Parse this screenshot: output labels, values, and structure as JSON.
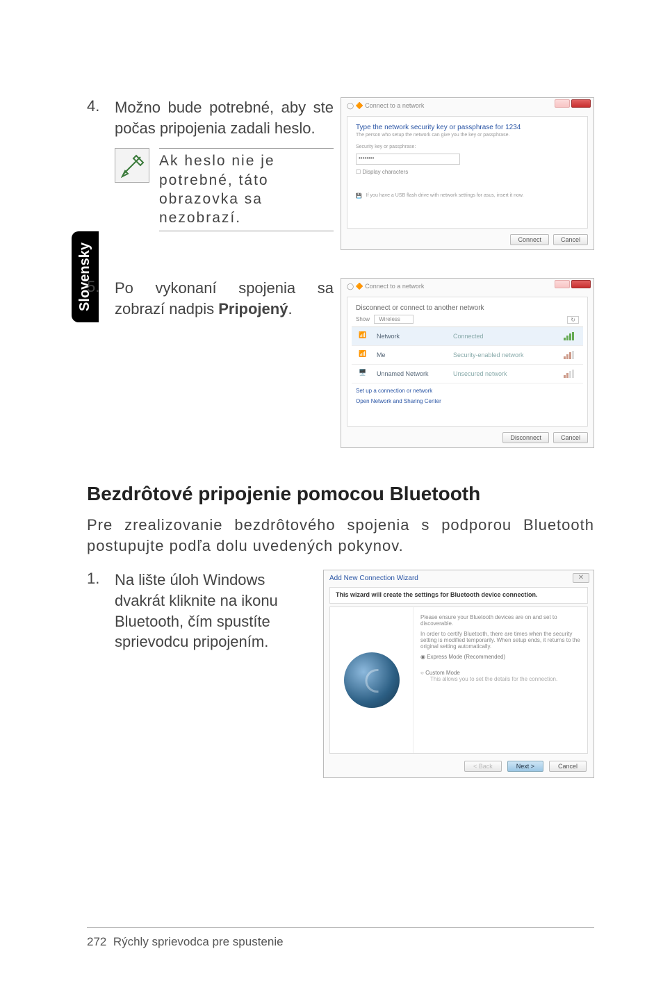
{
  "side_tab": "Slovensky",
  "step4": {
    "num": "4.",
    "text": "Možno bude potrebné, aby ste počas pripojenia zadali heslo."
  },
  "note4": {
    "text": "Ak heslo nie je potrebné, táto obrazovka sa nezobrazí."
  },
  "dialog4": {
    "title": "Connect to a network",
    "head": "Type the network security key or passphrase for 1234",
    "sub": "The person who setup the network can give you the key or passphrase.",
    "label1": "Security key or passphrase:",
    "input_value": "••••••••",
    "check": "Display characters",
    "hint": "If you have a USB flash drive with network settings for asus, insert it now.",
    "btn_connect": "Connect",
    "btn_cancel": "Cancel"
  },
  "step5": {
    "num": "5.",
    "text_a": "Po vykonaní spojenia sa zobrazí nadpis ",
    "text_bold": "Pripojený",
    "text_c": "."
  },
  "dialog5": {
    "title": "Connect to a network",
    "head": "Disconnect or connect to another network",
    "show": "Show",
    "show_val": "Wireless",
    "rows": [
      {
        "name": "Network",
        "status": "Connected"
      },
      {
        "name": "Me",
        "status": "Security-enabled network"
      },
      {
        "name": "Unnamed Network",
        "status": "Unsecured network"
      }
    ],
    "link1": "Set up a connection or network",
    "link2": "Open Network and Sharing Center",
    "btn_disconnect": "Disconnect",
    "btn_cancel": "Cancel"
  },
  "heading": "Bezdrôtové pripojenie pomocou Bluetooth",
  "para": "Pre zrealizovanie bezdrôtového spojenia s podporou Bluetooth postupujte podľa dolu uvedených pokynov.",
  "step_bt1": {
    "num": "1.",
    "text": "Na lište úloh Windows dvakrát kliknite na ikonu Bluetooth, čím spustíte sprievodcu pripojením."
  },
  "wizard": {
    "winhead": "Add New Connection Wizard",
    "whiteline": "This wizard will create the settings for Bluetooth device connection.",
    "body1": "Please ensure your Bluetooth devices are on and set to discoverable.",
    "body2": "In order to certify Bluetooth, there are times when the security setting is modified temporarily. When setup ends, it returns to the original setting automatically.",
    "radio1": "Express Mode (Recommended)",
    "radio2": "Custom Mode",
    "radio2_sub": "This allows you to set the details for the connection.",
    "btn_back": "< Back",
    "btn_next": "Next >",
    "btn_cancel": "Cancel"
  },
  "footer": {
    "page": "272",
    "title": "Rýchly sprievodca pre spustenie"
  }
}
